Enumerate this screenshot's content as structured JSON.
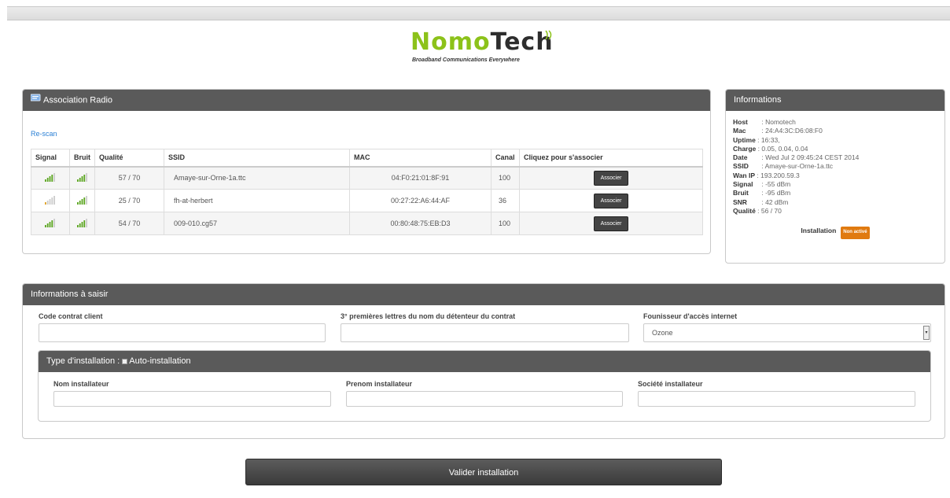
{
  "brand": {
    "name_part1": "Nomo",
    "name_part2": "Tech",
    "tagline": "Broadband Communications Everywhere"
  },
  "association": {
    "title": "Association Radio",
    "rescan_label": "Re-scan",
    "columns": [
      "Signal",
      "Bruit",
      "Qualité",
      "SSID",
      "MAC",
      "Canal",
      "Cliquez pour s'associer"
    ],
    "rows": [
      {
        "signal_level": 4,
        "noise_level": 4,
        "quality": "57 / 70",
        "ssid": "Amaye-sur-Orne-1a.ttc",
        "mac": "04:F0:21:01:8F:91",
        "canal": "100",
        "button": "Associer"
      },
      {
        "signal_level": 1,
        "noise_level": 4,
        "quality": "25 / 70",
        "ssid": "fh-at-herbert",
        "mac": "00:27:22:A6:44:AF",
        "canal": "36",
        "button": "Associer"
      },
      {
        "signal_level": 4,
        "noise_level": 4,
        "quality": "54 / 70",
        "ssid": "009-010.cg57",
        "mac": "00:80:48:75:EB:D3",
        "canal": "100",
        "button": "Associer"
      }
    ]
  },
  "informations": {
    "title": "Informations",
    "rows": [
      {
        "key": "Host",
        "value": "Nomotech"
      },
      {
        "key": "Mac",
        "value": "24:A4:3C:D6:08:F0"
      },
      {
        "key": "Uptime",
        "value": "16:33,"
      },
      {
        "key": "Charge",
        "value": "0.05, 0.04, 0.04"
      },
      {
        "key": "Date",
        "value": "Wed Jul 2 09:45:24 CEST 2014"
      },
      {
        "key": "SSID",
        "value": "Amaye-sur-Orne-1a.ttc"
      },
      {
        "key": "Wan IP",
        "value": "193.200.59.3"
      },
      {
        "key": "Signal",
        "value": "-55 dBm"
      },
      {
        "key": "Bruit",
        "value": "-95 dBm"
      },
      {
        "key": "SNR",
        "value": "42 dBm"
      },
      {
        "key": "Qualité",
        "value": "56 / 70"
      }
    ],
    "installation_label": "Installation",
    "installation_status": "Non activé"
  },
  "form": {
    "title": "Informations à saisir",
    "contract_label": "Code contrat client",
    "contract_value": "",
    "letters_label": "3° premières lettres du nom du détenteur du contrat",
    "letters_value": "",
    "isp_label": "Founisseur d'accès internet",
    "isp_value": "Ozone",
    "install_type_label": "Type d'installation :",
    "install_type_option": "Auto-installation",
    "installer_lastname_label": "Nom installateur",
    "installer_firstname_label": "Prenom installateur",
    "installer_company_label": "Société installateur"
  },
  "validate_label": "Valider installation",
  "colors": {
    "signal_on": "#5aa51e",
    "signal_weak": "#e0a020",
    "bar_off": "#cccccc",
    "header_bg": "#5a5a5a",
    "badge": "#e07a10",
    "link": "#2a7fd4"
  }
}
